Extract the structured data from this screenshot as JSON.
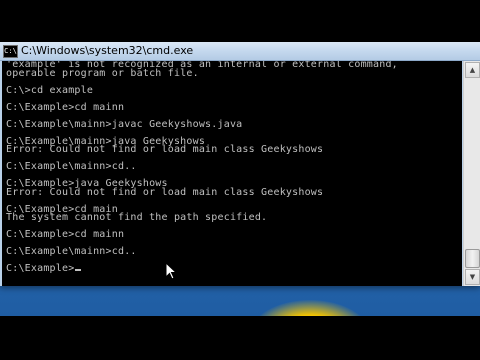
{
  "window": {
    "title": "C:\\Windows\\system32\\cmd.exe",
    "icon_label": "C:\\"
  },
  "console": {
    "lines": [
      "'example' is not recognized as an internal or external command,",
      "operable program or batch file.",
      "",
      "C:\\>cd example",
      "",
      "C:\\Example>cd mainn",
      "",
      "C:\\Example\\mainn>javac Geekyshows.java",
      "",
      "C:\\Example\\mainn>java Geekyshows",
      "Error: Could not find or load main class Geekyshows",
      "",
      "C:\\Example\\mainn>cd..",
      "",
      "C:\\Example>java Geekyshows",
      "Error: Could not find or load main class Geekyshows",
      "",
      "C:\\Example>cd main",
      "The system cannot find the path specified.",
      "",
      "C:\\Example>cd mainn",
      "",
      "C:\\Example\\mainn>cd..",
      "",
      "C:\\Example>"
    ]
  },
  "scrollbar": {
    "up_icon": "scroll-up-arrow-icon",
    "down_icon": "scroll-down-arrow-icon"
  },
  "colors": {
    "console_bg": "#000000",
    "console_text": "#c0c0c0",
    "desktop_bg": "#2f73b8"
  }
}
